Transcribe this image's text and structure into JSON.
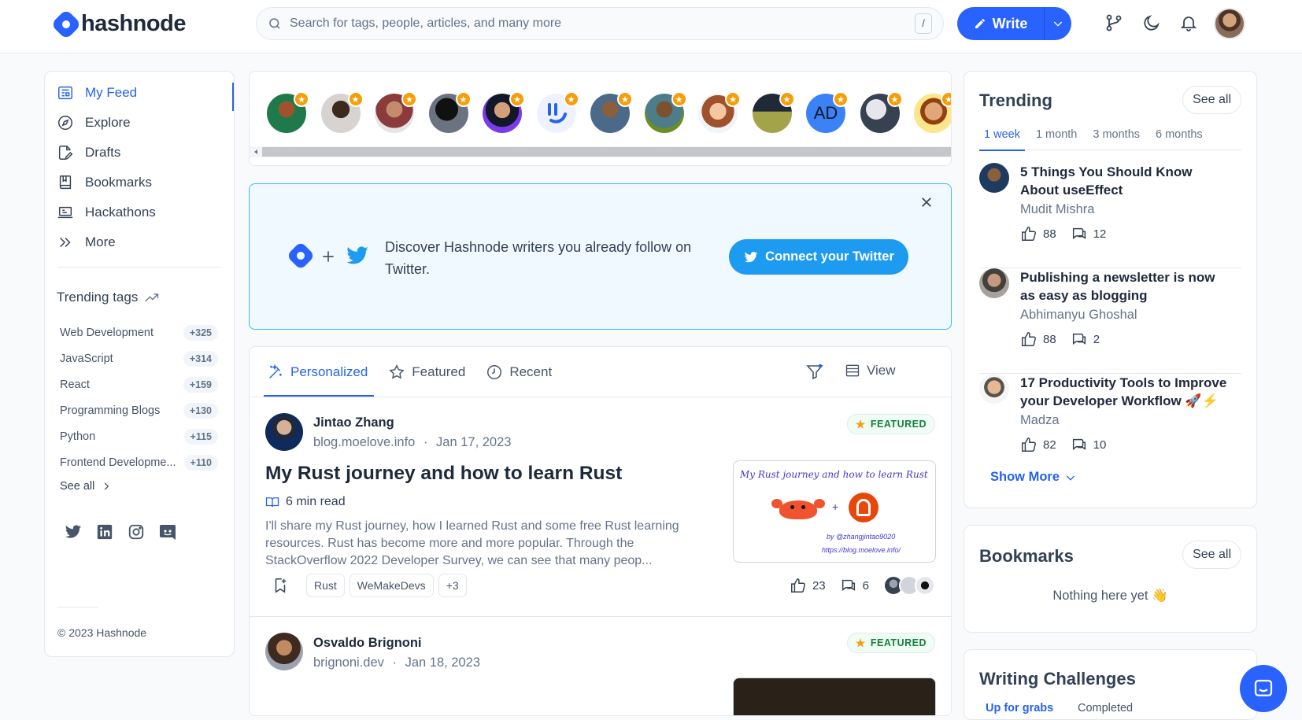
{
  "brand": {
    "name": "hashnode"
  },
  "search": {
    "placeholder": "Search for tags, people, articles, and many more",
    "shortcut": "/"
  },
  "header": {
    "write_label": "Write"
  },
  "nav": [
    {
      "label": "My Feed",
      "icon": "feed-icon"
    },
    {
      "label": "Explore",
      "icon": "compass-icon"
    },
    {
      "label": "Drafts",
      "icon": "draft-icon"
    },
    {
      "label": "Bookmarks",
      "icon": "bookmark-icon"
    },
    {
      "label": "Hackathons",
      "icon": "laptop-icon"
    },
    {
      "label": "More",
      "icon": "double-chevron-icon"
    }
  ],
  "trending_tags": {
    "title": "Trending tags",
    "items": [
      {
        "name": "Web Development",
        "count": "+325"
      },
      {
        "name": "JavaScript",
        "count": "+314"
      },
      {
        "name": "React",
        "count": "+159"
      },
      {
        "name": "Programming Blogs",
        "count": "+130"
      },
      {
        "name": "Python",
        "count": "+115"
      },
      {
        "name": "Frontend Developme...",
        "count": "+110"
      }
    ],
    "see_all": "See all"
  },
  "footer": {
    "copyright": "© 2023 Hashnode"
  },
  "twitter_card": {
    "text": "Discover Hashnode writers you already follow on Twitter.",
    "button": "Connect your Twitter"
  },
  "people_avatars": [
    "AD"
  ],
  "feed_tabs": [
    {
      "label": "Personalized"
    },
    {
      "label": "Featured"
    },
    {
      "label": "Recent"
    }
  ],
  "feed_view_label": "View",
  "posts": [
    {
      "author": "Jintao Zhang",
      "blog": "blog.moelove.info",
      "date": "Jan 17, 2023",
      "badge": "FEATURED",
      "title": "My Rust journey and how to learn Rust",
      "read_time": "6 min read",
      "excerpt": "I'll share my Rust journey, how I learned Rust and some free Rust learning resources. Rust has become more and more popular. Through the StackOverflow 2022 Developer Survey, we can see that many peop...",
      "tags": [
        "Rust",
        "WeMakeDevs",
        "+3"
      ],
      "likes": "23",
      "comments": "6",
      "thumb_title": "My Rust journey and how to learn Rust",
      "thumb_handle": "by @zhangjintao9020",
      "thumb_url": "https://blog.moelove.info/"
    },
    {
      "author": "Osvaldo Brignoni",
      "blog": "brignoni.dev",
      "date": "Jan 18, 2023",
      "badge": "FEATURED"
    }
  ],
  "trending": {
    "title": "Trending",
    "see_all": "See all",
    "tabs": [
      "1 week",
      "1 month",
      "3 months",
      "6 months"
    ],
    "items": [
      {
        "title": "5 Things You Should Know About useEffect",
        "author": "Mudit Mishra",
        "likes": "88",
        "comments": "12"
      },
      {
        "title": "Publishing a newsletter is now as easy as blogging",
        "author": "Abhimanyu Ghoshal",
        "likes": "88",
        "comments": "2"
      },
      {
        "title": "17 Productivity Tools to Improve your Developer Workflow 🚀⚡",
        "author": "Madza",
        "likes": "82",
        "comments": "10"
      }
    ],
    "show_more": "Show More"
  },
  "bookmarks": {
    "title": "Bookmarks",
    "see_all": "See all",
    "empty": "Nothing here yet 👋"
  },
  "challenges": {
    "title": "Writing Challenges",
    "tabs": [
      "Up for grabs",
      "Completed"
    ]
  },
  "colors": {
    "accent": "#2962ff",
    "twitter": "#1d9bf0",
    "featured_text": "#15803d",
    "star": "#f59e0b"
  }
}
